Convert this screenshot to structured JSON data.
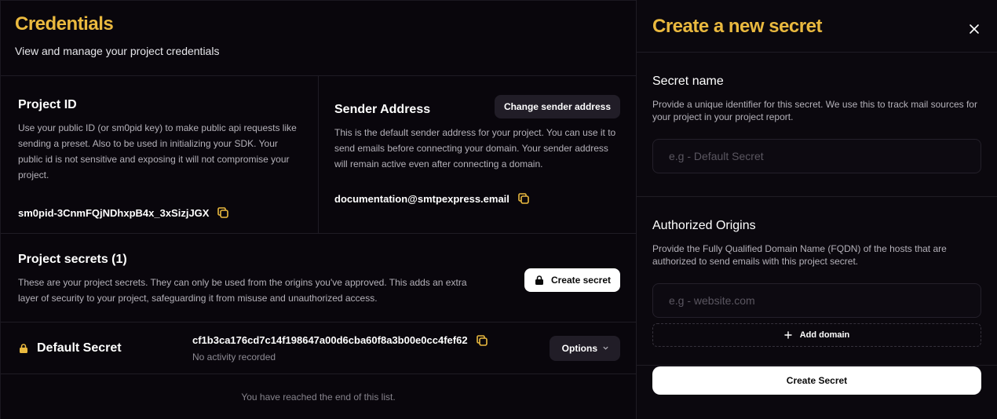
{
  "page": {
    "title": "Credentials",
    "subtitle": "View and manage your project credentials"
  },
  "project_id": {
    "title": "Project ID",
    "description": "Use your public ID (or sm0pid key) to make public api requests like sending a preset. Also to be used in initializing your SDK. Your public id is not sensitive and exposing it will not compromise your project.",
    "value": "sm0pid-3CnmFQjNDhxpB4x_3xSizjJGX"
  },
  "sender_address": {
    "title": "Sender Address",
    "change_label": "Change sender address",
    "description": "This is the default sender address for your project. You can use it to send emails before connecting your domain. Your sender address will remain active even after connecting a domain.",
    "value": "documentation@smtpexpress.email"
  },
  "secrets": {
    "title": "Project secrets (1)",
    "description": "These are your project secrets. They can only be used from the origins you've approved. This adds an extra layer of security to your project, safeguarding it from misuse and unauthorized access.",
    "create_label": "Create secret",
    "items": [
      {
        "name": "Default Secret",
        "key": "cf1b3ca176cd7c14f198647a00d6cba60f8a3b00e0cc4fef62",
        "activity": "No activity recorded",
        "options_label": "Options"
      }
    ],
    "end_note": "You have reached the end of this list."
  },
  "panel": {
    "title": "Create a new secret",
    "secret_name": {
      "label": "Secret name",
      "description": "Provide a unique identifier for this secret. We use this to track mail sources for your project in your project report.",
      "placeholder": "e.g - Default Secret"
    },
    "origins": {
      "label": "Authorized Origins",
      "description": "Provide the Fully Qualified Domain Name (FQDN) of the hosts that are authorized to send emails with this project secret.",
      "placeholder": "e.g - website.com",
      "add_label": "Add domain"
    },
    "submit_label": "Create Secret"
  },
  "colors": {
    "accent": "#eab93f",
    "background": "#09060c",
    "border": "#1f1c24"
  }
}
